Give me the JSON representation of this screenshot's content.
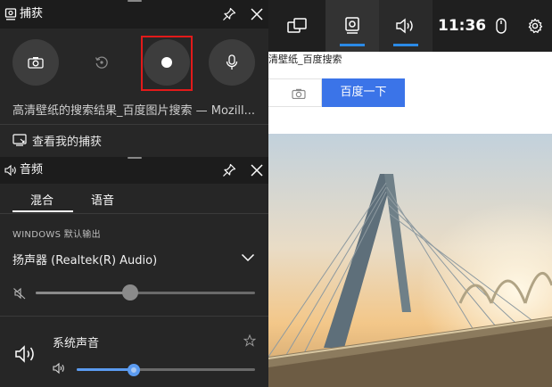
{
  "browser": {
    "result_heading": "清壁纸_百度搜索",
    "search_button": "百度一下"
  },
  "topbar": {
    "clock": "11:36",
    "items": [
      {
        "icon": "widget-menu-icon",
        "active": false
      },
      {
        "icon": "capture-icon",
        "active": true
      },
      {
        "icon": "audio-icon",
        "active": true
      },
      {
        "icon": "mouse-icon",
        "active": false
      },
      {
        "icon": "gear-icon",
        "active": false
      }
    ]
  },
  "capture": {
    "title": "捕获",
    "buttons": [
      {
        "icon": "camera-icon",
        "action": "screenshot"
      },
      {
        "icon": "replay-icon",
        "action": "record-last"
      },
      {
        "icon": "record-dot-icon",
        "action": "start-recording",
        "highlighted": true
      },
      {
        "icon": "microphone-icon",
        "action": "microphone"
      }
    ],
    "window_title": "高清壁纸的搜索结果_百度图片搜索 — Mozill...",
    "view_captures": "查看我的捕获"
  },
  "audio": {
    "title": "音频",
    "tabs": [
      {
        "label": "混合",
        "active": true
      },
      {
        "label": "语音",
        "active": false
      }
    ],
    "output_label": "WINDOWS 默认输出",
    "device": "扬声器 (Realtek(R) Audio)",
    "master_volume": 0.43,
    "system_label": "系统声音",
    "system_volume": 0.32,
    "accent_color": "#5b9bf0"
  }
}
